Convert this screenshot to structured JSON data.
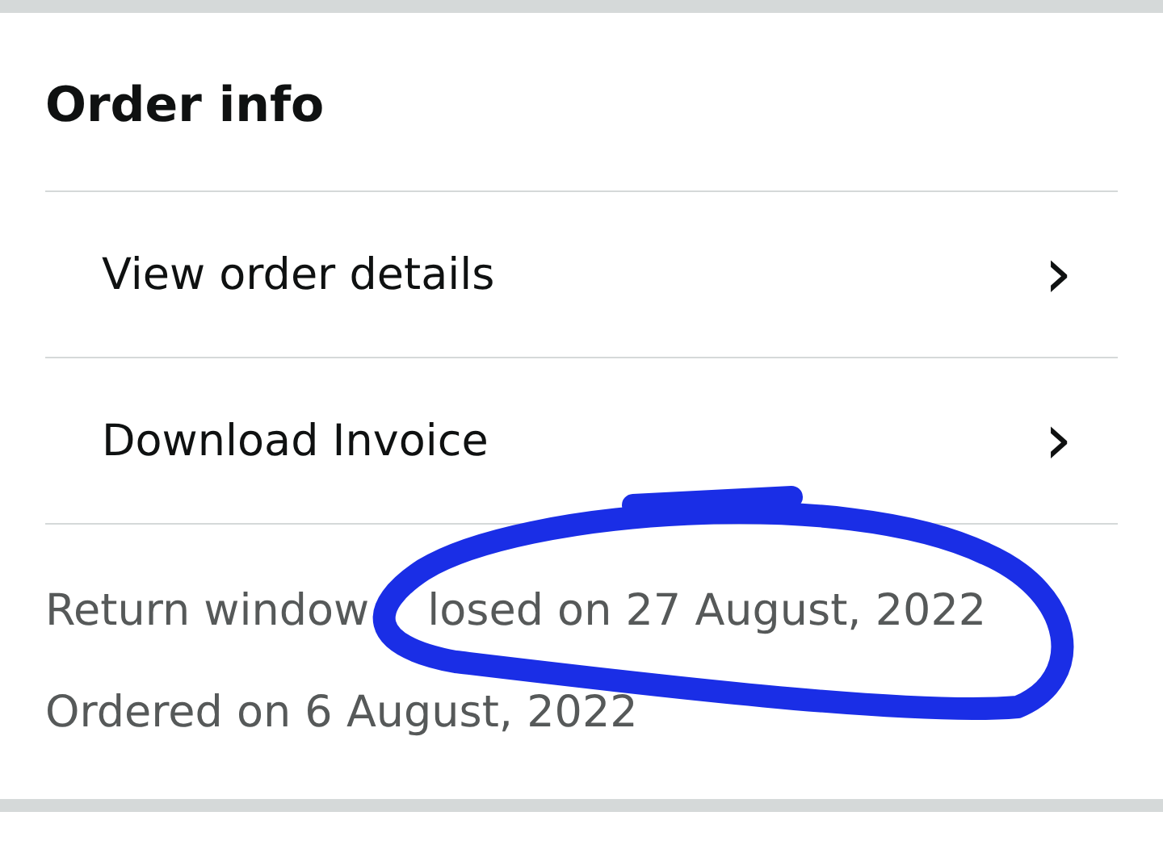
{
  "section": {
    "title": "Order info"
  },
  "links": [
    {
      "label": "View order details",
      "icon": "›"
    },
    {
      "label": "Download Invoice",
      "icon": "›"
    }
  ],
  "info": [
    [
      "Return window",
      "losed on 27 August, 2022"
    ],
    [
      "Ordered on 6 August, 2022"
    ]
  ],
  "annotation": {
    "kind": "ellipse"
  }
}
